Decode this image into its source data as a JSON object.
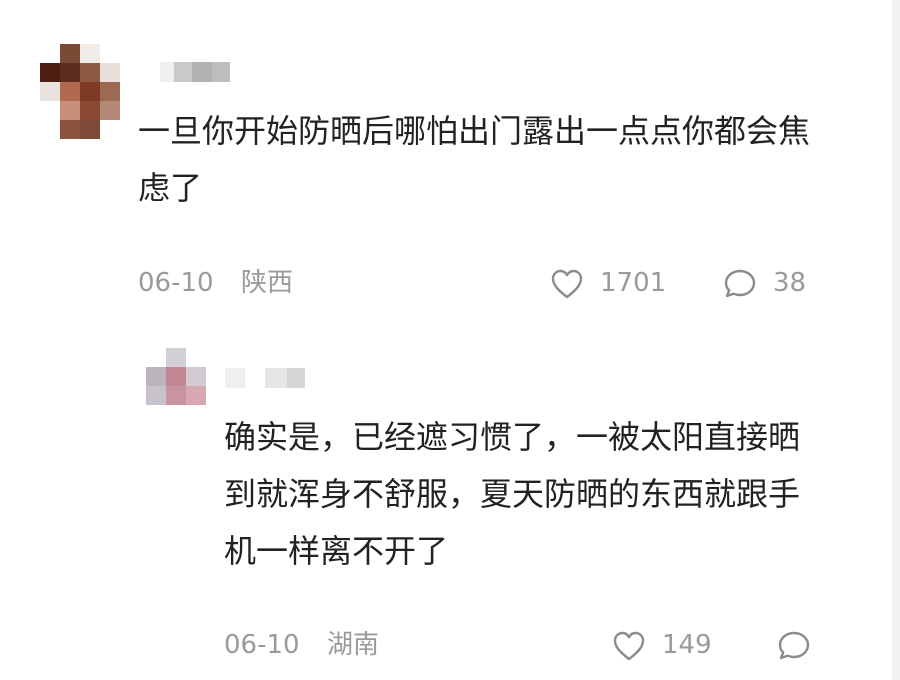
{
  "comment": {
    "author_name_blurred": "",
    "text": "一旦你开始防晒后哪怕出门露出一点点你都会焦虑了",
    "date": "06-10",
    "location": "陕西",
    "like_count": "1701",
    "reply_count": "38",
    "like_icon": "heart-outline-icon",
    "reply_icon": "comment-bubble-icon"
  },
  "reply": {
    "author_name_blurred": "",
    "text": "确实是，已经遮习惯了，一被太阳直接晒到就浑身不舒服，夏天防晒的东西就跟手机一样离不开了",
    "date": "06-10",
    "location": "湖南",
    "like_count": "149",
    "like_icon": "heart-outline-icon",
    "reply_icon": "comment-bubble-icon"
  },
  "colors": {
    "text": "#222222",
    "meta": "#9a9a9a",
    "icon": "#8c8c8c",
    "background": "#ffffff"
  }
}
